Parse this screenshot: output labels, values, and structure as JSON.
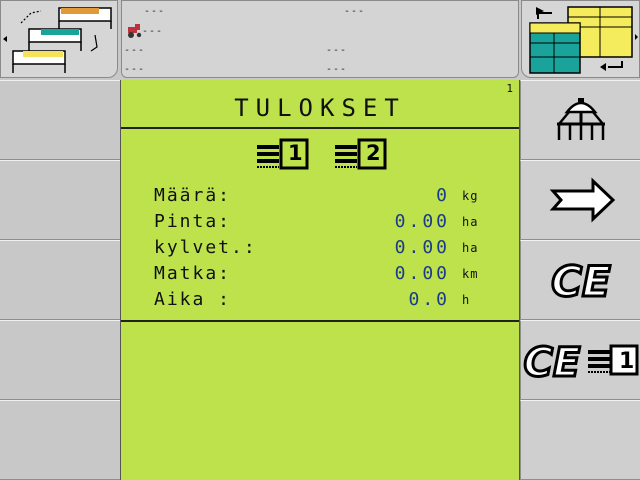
{
  "status": {
    "row1_left": "---",
    "row1_right": "---",
    "row2_left": "---",
    "row3_left": "---",
    "row3_right": "---",
    "row4_left": "---",
    "row4_right": "---"
  },
  "panel": {
    "page_number": "1",
    "title": "TULOKSET",
    "counter_tabs": [
      "1",
      "2"
    ],
    "rows": [
      {
        "label": "Määrä:",
        "value": "0",
        "unit": "kg"
      },
      {
        "label": "Pinta:",
        "value": "0.00",
        "unit": "ha"
      },
      {
        "label": "kylvet.:",
        "value": "0.00",
        "unit": "ha"
      },
      {
        "label": "Matka:",
        "value": "0.00",
        "unit": "km"
      },
      {
        "label": "Aika :",
        "value": "0.0",
        "unit": "h"
      }
    ]
  },
  "softkeys_right": {
    "ce_combo_number": "1"
  },
  "colors": {
    "panel": "#bde24b",
    "value_text": "#1c3c8a"
  }
}
